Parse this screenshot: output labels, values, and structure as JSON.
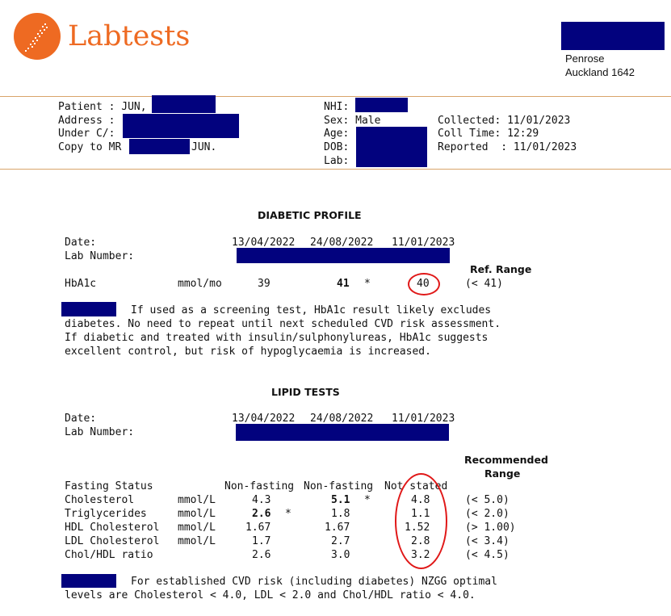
{
  "brand": {
    "name": "Labtests",
    "logo_icon": "labtests-logo-icon",
    "accent_color": "#ee6a22"
  },
  "address": {
    "line1": "Penrose",
    "line2": "Auckland 1642"
  },
  "patient": {
    "patient_label": "Patient : JUN,",
    "address_label": "Address :",
    "under_label": "Under C/:",
    "copy_label": "Copy to MR",
    "copy_suffix": "JUN.",
    "nhi_label": "NHI:",
    "sex_text": "Sex: Male",
    "age_label": "Age:",
    "dob_label": "DOB:",
    "lab_label": "Lab:",
    "collected": "Collected: 11/01/2023",
    "coll_time": "Coll Time: 12:29",
    "reported": "Reported  : 11/01/2023"
  },
  "diabetic": {
    "title": "DIABETIC PROFILE",
    "date_label": "Date:",
    "lab_number_label": "Lab Number:",
    "dates": [
      "13/04/2022",
      "24/08/2022",
      "11/01/2023"
    ],
    "ref_range_header": "Ref. Range",
    "row": {
      "name": "HbA1c",
      "unit": "mmol/mo",
      "v1": "39",
      "v2": "41",
      "flag": "*",
      "v3": "40",
      "range": "(< 41)"
    },
    "comment": [
      "If used as a screening test, HbA1c result likely excludes",
      "diabetes. No need to repeat until next scheduled CVD risk assessment.",
      "If diabetic and treated with insulin/sulphonylureas, HbA1c suggests",
      "excellent control, but risk of hypoglycaemia is increased."
    ]
  },
  "lipid": {
    "title": "LIPID TESTS",
    "date_label": "Date:",
    "lab_number_label": "Lab Number:",
    "dates": [
      "13/04/2022",
      "24/08/2022",
      "11/01/2023"
    ],
    "recommended_header_1": "Recommended",
    "recommended_header_2": "Range",
    "fasting": {
      "name": "Fasting Status",
      "v1": "Non-fasting",
      "v2": "Non-fasting",
      "v3": "Not stated"
    },
    "rows": [
      {
        "name": "Cholesterol",
        "unit": "mmol/L",
        "v1": "4.3",
        "f1": "",
        "v2": "5.1",
        "f2": "*",
        "v3": "4.8",
        "range": "(< 5.0)"
      },
      {
        "name": "Triglycerides",
        "unit": "mmol/L",
        "v1": "2.6",
        "f1": "*",
        "v2": "1.8",
        "f2": "",
        "v3": "1.1",
        "range": "(< 2.0)"
      },
      {
        "name": "HDL Cholesterol",
        "unit": "mmol/L",
        "v1": "1.67",
        "f1": "",
        "v2": "1.67",
        "f2": "",
        "v3": "1.52",
        "range": "(> 1.00)"
      },
      {
        "name": "LDL Cholesterol",
        "unit": "mmol/L",
        "v1": "1.7",
        "f1": "",
        "v2": "2.7",
        "f2": "",
        "v3": "2.8",
        "range": "(< 3.4)"
      },
      {
        "name": "Chol/HDL ratio",
        "unit": "",
        "v1": "2.6",
        "f1": "",
        "v2": "3.0",
        "f2": "",
        "v3": "3.2",
        "range": "(< 4.5)"
      }
    ],
    "comment": [
      "For established CVD risk (including diabetes) NZGG optimal",
      "levels are Cholesterol < 4.0, LDL < 2.0 and Chol/HDL ratio < 4.0."
    ]
  }
}
